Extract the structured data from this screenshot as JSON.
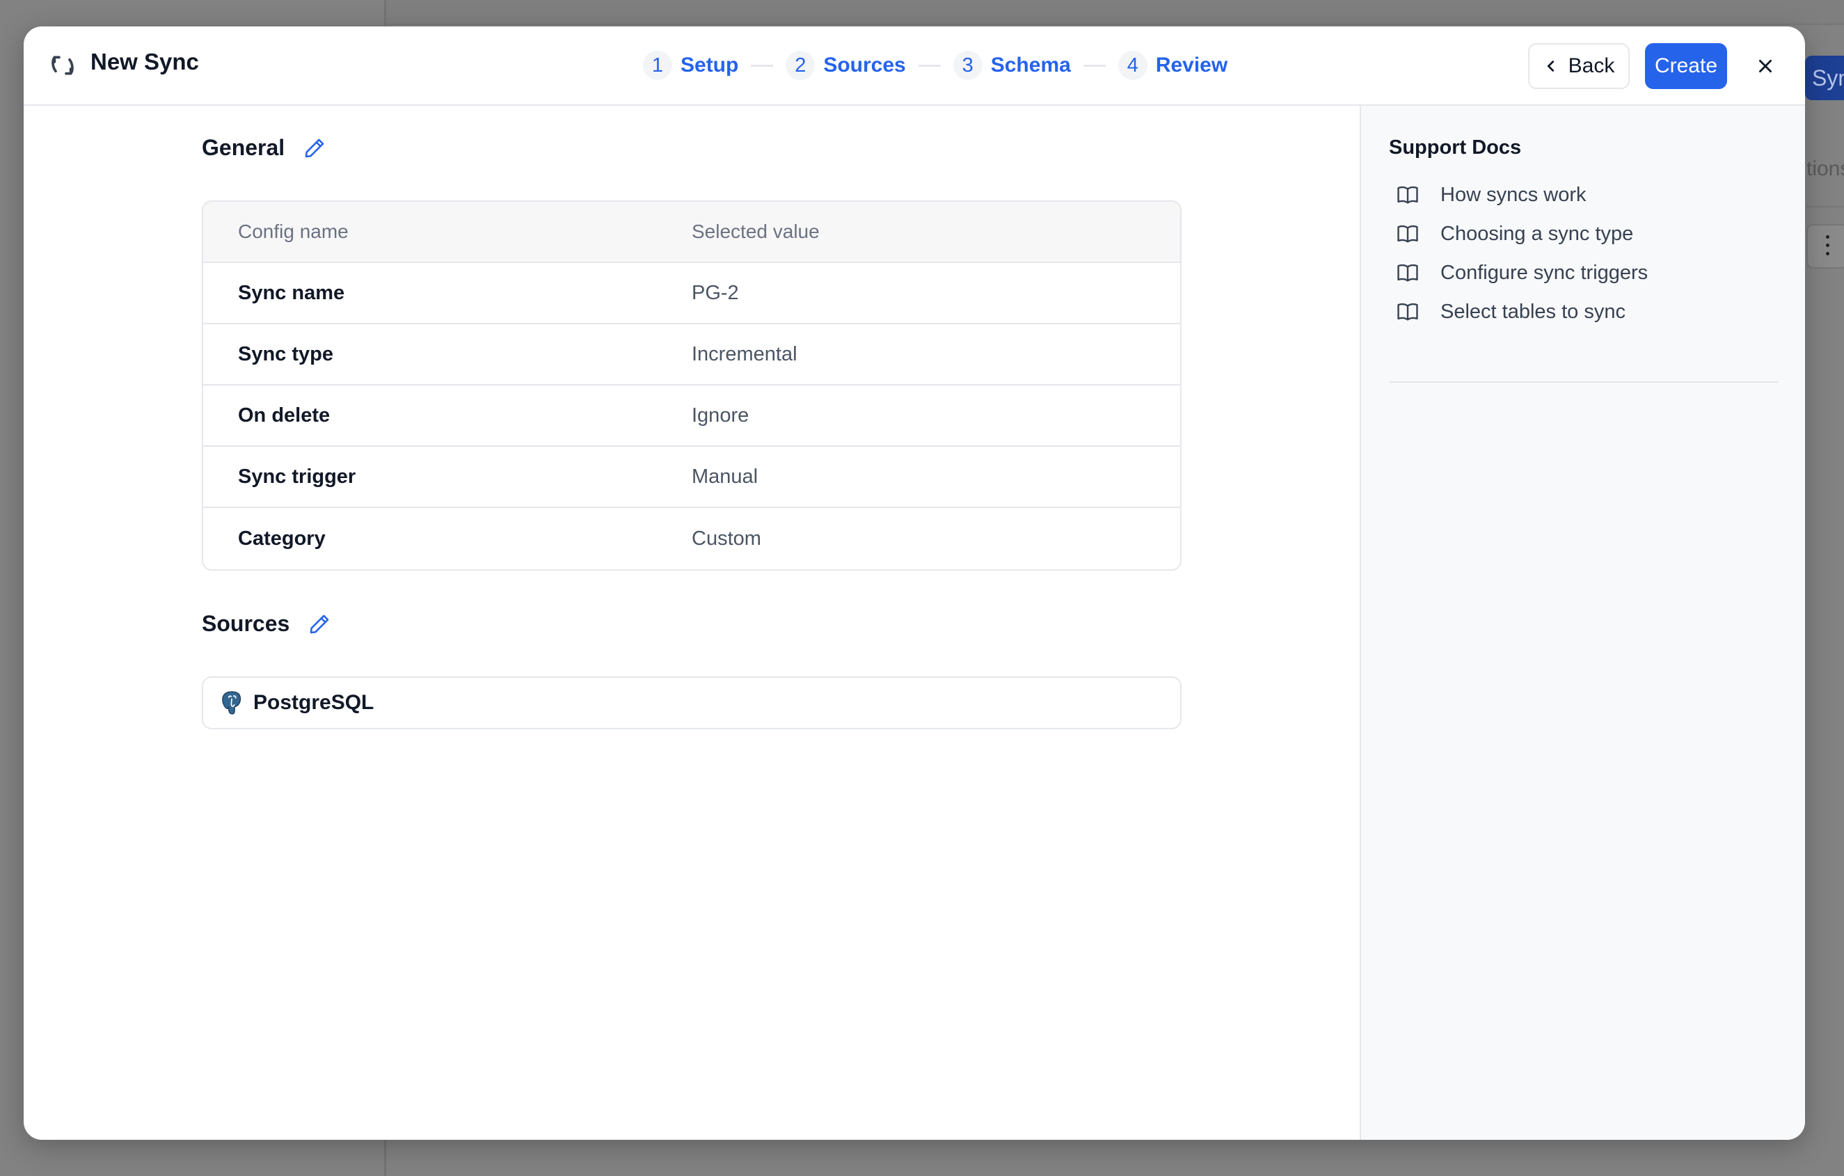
{
  "background": {
    "button_label": "Sync",
    "text": "tions"
  },
  "modal": {
    "title": "New Sync",
    "title_icon": "sync-icon",
    "steps": [
      {
        "number": "1",
        "label": "Setup"
      },
      {
        "number": "2",
        "label": "Sources"
      },
      {
        "number": "3",
        "label": "Schema"
      },
      {
        "number": "4",
        "label": "Review"
      }
    ],
    "back_label": "Back",
    "create_label": "Create",
    "accent_color": "#2563eb"
  },
  "general": {
    "title": "General",
    "columns": [
      "Config name",
      "Selected value"
    ],
    "rows": [
      {
        "name": "Sync name",
        "value": "PG-2"
      },
      {
        "name": "Sync type",
        "value": "Incremental"
      },
      {
        "name": "On delete",
        "value": "Ignore"
      },
      {
        "name": "Sync trigger",
        "value": "Manual"
      },
      {
        "name": "Category",
        "value": "Custom"
      }
    ]
  },
  "sources": {
    "title": "Sources",
    "items": [
      {
        "name": "PostgreSQL",
        "icon": "postgresql-icon"
      }
    ]
  },
  "support_docs": {
    "title": "Support Docs",
    "links": [
      "How syncs work",
      "Choosing a sync type",
      "Configure sync triggers",
      "Select tables to sync"
    ]
  }
}
